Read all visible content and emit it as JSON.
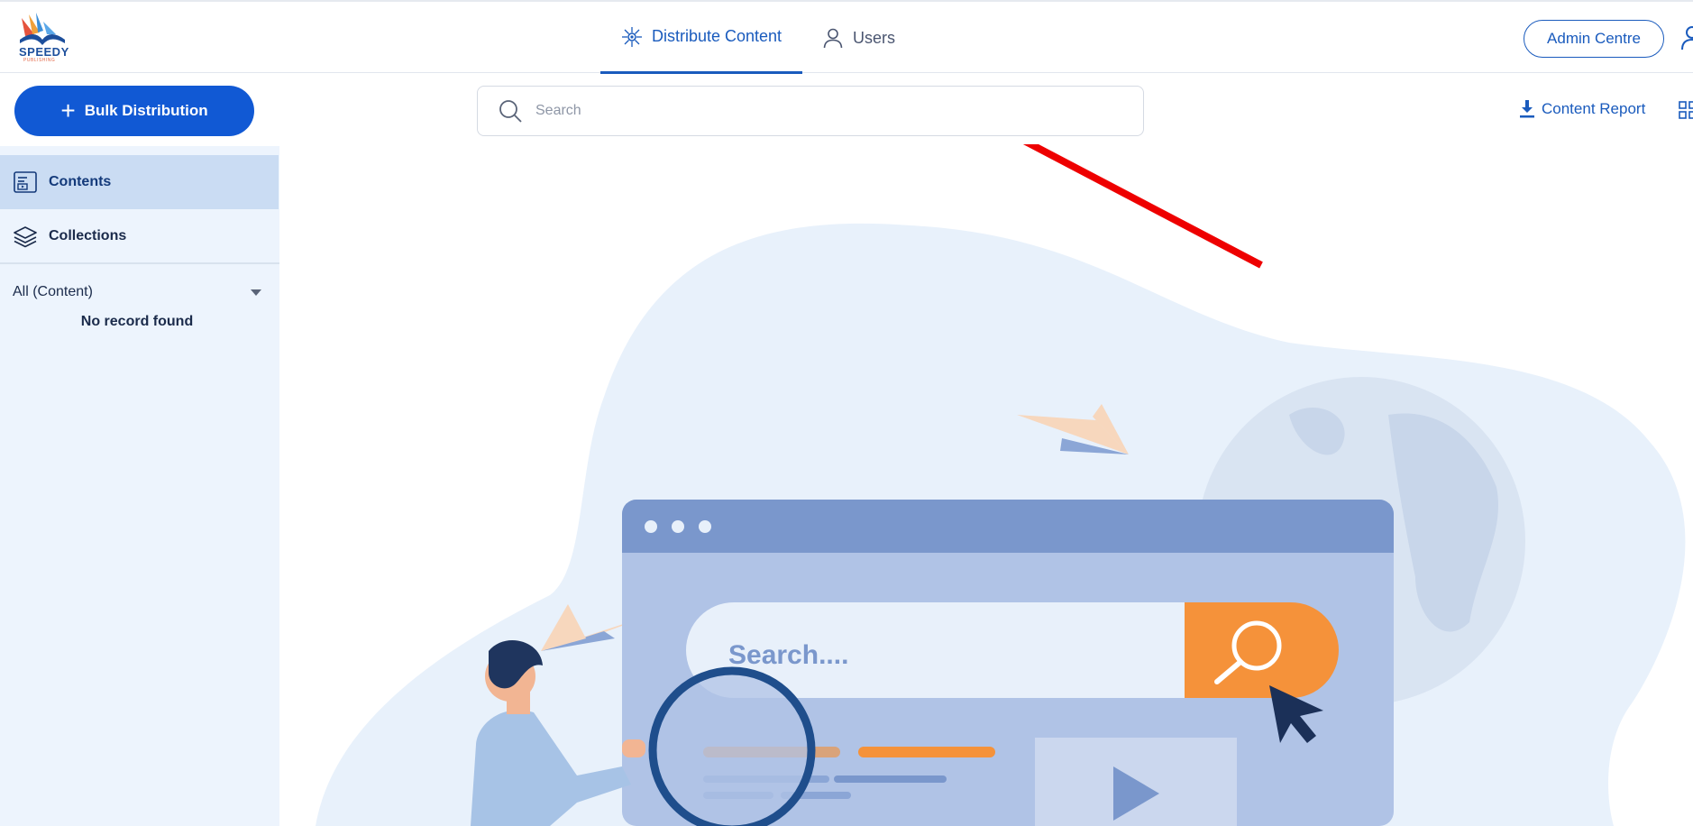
{
  "header": {
    "logo": {
      "text": "SPEEDY",
      "subtext": "PUBLISHING"
    },
    "tabs": [
      {
        "label": "Distribute Content",
        "icon": "network-icon",
        "active": true
      },
      {
        "label": "Users",
        "icon": "user-icon",
        "active": false
      }
    ],
    "admin_label": "Admin Centre",
    "profile_icon": "profile-icon"
  },
  "sidebar": {
    "bulk_label": "Bulk Distribution",
    "items": [
      {
        "label": "Contents",
        "icon": "contents-icon",
        "active": true
      },
      {
        "label": "Collections",
        "icon": "layers-icon",
        "active": false
      }
    ],
    "filter_label": "All (Content)",
    "empty_text": "No record found"
  },
  "main": {
    "search_placeholder": "Search",
    "report_label": "Content Report",
    "report_icon": "download-icon",
    "view_icon": "grid-view-icon"
  },
  "illustration": {
    "search_text": "Search...."
  },
  "colors": {
    "primary": "#1159d4",
    "accent": "#1a5bbd",
    "sidebar_bg": "#edf4fd",
    "active_item": "#cadcf3",
    "orange": "#f5923a",
    "annotation_red": "#ee0000"
  }
}
